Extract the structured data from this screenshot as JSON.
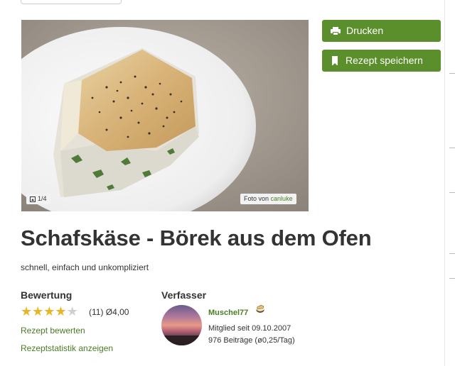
{
  "actions": {
    "print_label": "Drucken",
    "save_label": "Rezept speichern"
  },
  "photo": {
    "counter": "1/4",
    "credit_prefix": "Foto von",
    "credit_author": "canluke"
  },
  "recipe": {
    "title": "Schafskäse - Börek aus dem Ofen",
    "subtitle": "schnell, einfach und unkompliziert"
  },
  "rating": {
    "heading": "Bewertung",
    "stars": 4,
    "max_stars": 5,
    "count_text": "(11) Ø4,00",
    "rate_link": "Rezept bewerten",
    "stats_link": "Rezeptstatistik anzeigen"
  },
  "author": {
    "heading": "Verfasser",
    "name": "Muschel77",
    "member_since": "Mitglied seit 09.10.2007",
    "posts": "976 Beiträge (ø0,25/Tag)"
  },
  "colors": {
    "accent_green": "#5b8f2b",
    "link_green": "#4b7c25",
    "star_gold": "#e8b526"
  }
}
